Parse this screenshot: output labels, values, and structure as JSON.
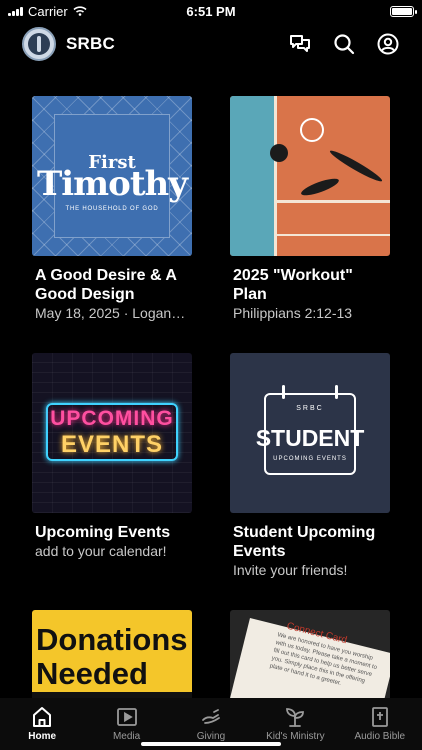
{
  "status_bar": {
    "carrier": "Carrier",
    "time": "6:51 PM"
  },
  "header": {
    "app_name": "SRBC"
  },
  "cards": [
    {
      "title": "A Good Desire & A Good Design",
      "subtitle": "May 18, 2025 · Logan…",
      "thumb": {
        "line1": "First",
        "line2": "Timothy",
        "line3": "THE HOUSEHOLD OF GOD"
      }
    },
    {
      "title": "2025 \"Workout\" Plan",
      "subtitle": "Philippians 2:12-13"
    },
    {
      "title": "Upcoming Events",
      "subtitle": "add to your calendar!",
      "thumb": {
        "line1": "UPCOMING",
        "line2": "EVENTS"
      }
    },
    {
      "title": "Student Upcoming Events",
      "subtitle": "Invite your friends!",
      "thumb": {
        "line1": "SRBC",
        "line2": "STUDENT",
        "line3": "UPCOMING EVENTS"
      }
    },
    {
      "title": "",
      "subtitle": "",
      "thumb": {
        "line1": "Donations",
        "line2": "Needed"
      }
    },
    {
      "title": "",
      "subtitle": "",
      "thumb": {
        "line1": "Connect Card",
        "line2": "We are honored to have you worship with us today. Please take a moment to fill out this card to help us better serve you. Simply place this in the offering plate or hand it to a greeter."
      }
    }
  ],
  "tabs": [
    {
      "label": "Home",
      "icon": "home-icon",
      "active": true
    },
    {
      "label": "Media",
      "icon": "media-play-icon",
      "active": false
    },
    {
      "label": "Giving",
      "icon": "giving-hand-icon",
      "active": false
    },
    {
      "label": "Kid's Ministry",
      "icon": "sprout-icon",
      "active": false
    },
    {
      "label": "Audio Bible",
      "icon": "bible-icon",
      "active": false
    }
  ],
  "colors": {
    "background": "#000000",
    "tab_active": "#ffffff",
    "tab_inactive": "#9a9a9a"
  }
}
